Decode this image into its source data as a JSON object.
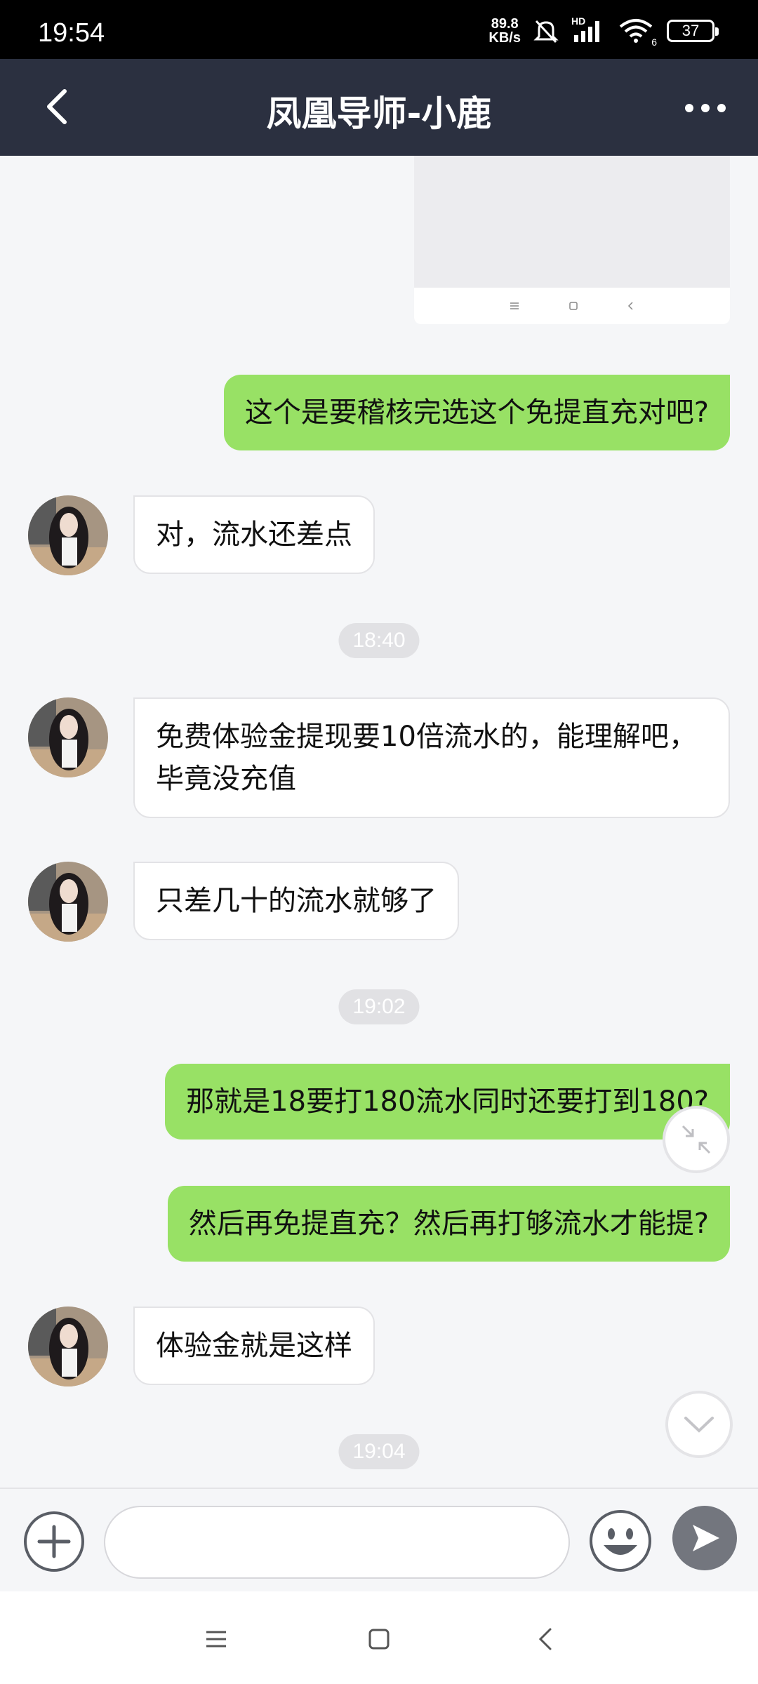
{
  "status_bar": {
    "time": "19:54",
    "net_speed_value": "89.8",
    "net_speed_unit": "KB/s",
    "signal_label": "HD",
    "wifi_label": "6",
    "battery": "37"
  },
  "header": {
    "title": "凤凰导师-小鹿"
  },
  "messages": [
    {
      "from": "me",
      "text": "这个是要稽核完选这个免提直充对吧?"
    },
    {
      "from": "other",
      "text": "对，流水还差点"
    },
    {
      "time": "18:40"
    },
    {
      "from": "other",
      "text": "免费体验金提现要10倍流水的，能理解吧，毕竟没充值"
    },
    {
      "from": "other",
      "text": "只差几十的流水就够了"
    },
    {
      "time": "19:02"
    },
    {
      "from": "me",
      "text": "那就是18要打180流水同时还要打到180?"
    },
    {
      "from": "me",
      "text": "然后再免提直充？然后再打够流水才能提?"
    },
    {
      "from": "other",
      "text": "体验金就是这样"
    },
    {
      "time": "19:04"
    }
  ],
  "input": {
    "value": "",
    "placeholder": ""
  },
  "colors": {
    "header_bg": "#2b3040",
    "my_bubble": "#98e165",
    "other_bubble": "#ffffff",
    "chat_bg": "#f5f6f8",
    "send_button": "#73767e"
  },
  "icons": {
    "back": "chevron-left-icon",
    "more": "more-dots-icon",
    "plus": "plus-circle-icon",
    "emoji": "smiley-icon",
    "send": "send-arrow-icon",
    "collapse": "collapse-arrows-icon",
    "scroll_down": "chevron-down-icon"
  }
}
